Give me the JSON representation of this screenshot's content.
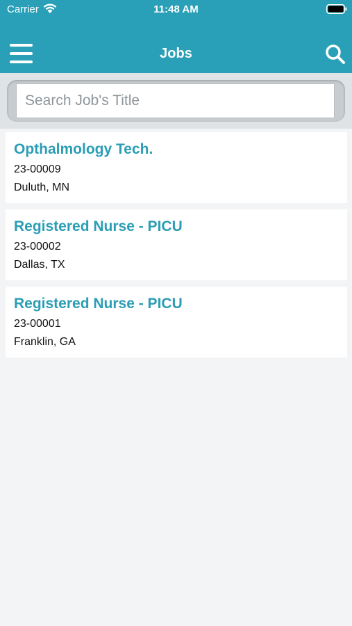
{
  "status_bar": {
    "carrier": "Carrier",
    "time": "11:48 AM"
  },
  "nav": {
    "title": "Jobs",
    "menu_icon": "hamburger-menu-icon",
    "search_icon": "search-icon"
  },
  "search": {
    "placeholder": "Search Job's Title",
    "value": ""
  },
  "jobs": [
    {
      "title": "Opthalmology Tech.",
      "id": "23-00009",
      "location": "Duluth, MN"
    },
    {
      "title": "Registered Nurse - PICU",
      "id": "23-00002",
      "location": "Dallas, TX"
    },
    {
      "title": "Registered Nurse - PICU",
      "id": "23-00001",
      "location": "Franklin, GA"
    }
  ],
  "colors": {
    "header": "#2aa0b8",
    "job_title": "#2b9db5",
    "background": "#f3f4f5"
  }
}
